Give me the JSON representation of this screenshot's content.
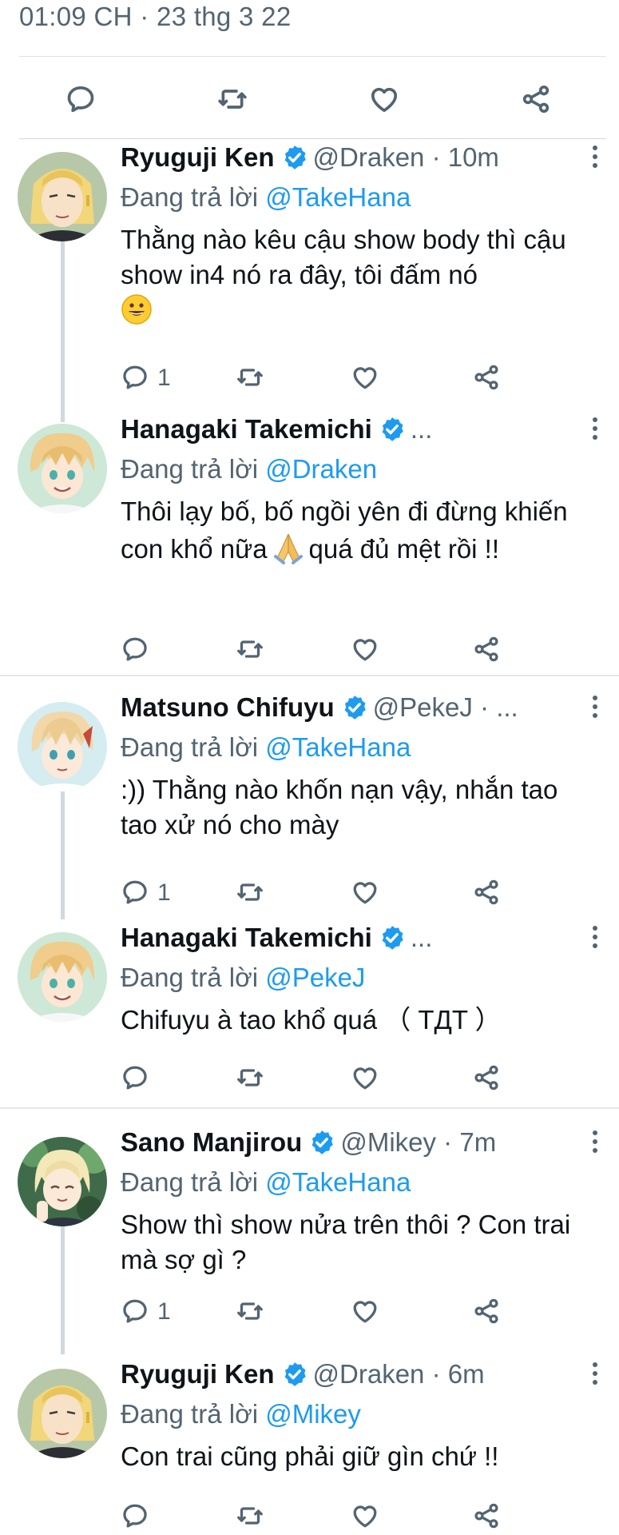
{
  "top": {
    "timestamp": "01:09 CH · 23 thg 3 22"
  },
  "icons": {
    "reply": "reply-icon",
    "retweet": "retweet-icon",
    "like": "heart-icon",
    "share": "share-icon",
    "verified": "verified-badge-icon",
    "more": "more-vertical-icon"
  },
  "colors": {
    "accent": "#1d9bf0",
    "muted": "#536471",
    "text": "#0f1419"
  },
  "reply_prefix": "Đang trả lời",
  "tweets": [
    {
      "name": "Ryuguji Ken",
      "handle": "@Draken · 10m",
      "reply_to": "@TakeHana",
      "text": "Thằng nào kêu cậu show body thì cậu show in4 nó ra đây, tôi đấm nó",
      "reply_count": "1"
    },
    {
      "name": "Hanagaki Takemichi",
      "handle": "...",
      "reply_to": "@Draken",
      "text_before": "Thôi lạy bố, bố ngồi yên đi đừng khiến con khổ nữa",
      "text_after": "quá đủ mệt rồi !!",
      "reply_count": ""
    },
    {
      "name": "Matsuno Chifuyu",
      "handle": "@PekeJ · ...",
      "reply_to": "@TakeHana",
      "text": ":)) Thằng nào khốn nạn vậy, nhắn tao tao xử nó cho mày",
      "reply_count": "1"
    },
    {
      "name": "Hanagaki Takemichi",
      "handle": "...",
      "reply_to": "@PekeJ",
      "text": "Chifuyu à tao khổ quá （ TДT ）",
      "reply_count": ""
    },
    {
      "name": "Sano Manjirou",
      "handle": "@Mikey · 7m",
      "reply_to": "@TakeHana",
      "text": "Show thì show nửa trên thôi ? Con trai mà sợ gì ?",
      "reply_count": "1"
    },
    {
      "name": "Ryuguji Ken",
      "handle": "@Draken · 6m",
      "reply_to": "@Mikey",
      "text": "Con trai cũng phải giữ gìn chứ !!",
      "reply_count": ""
    }
  ]
}
